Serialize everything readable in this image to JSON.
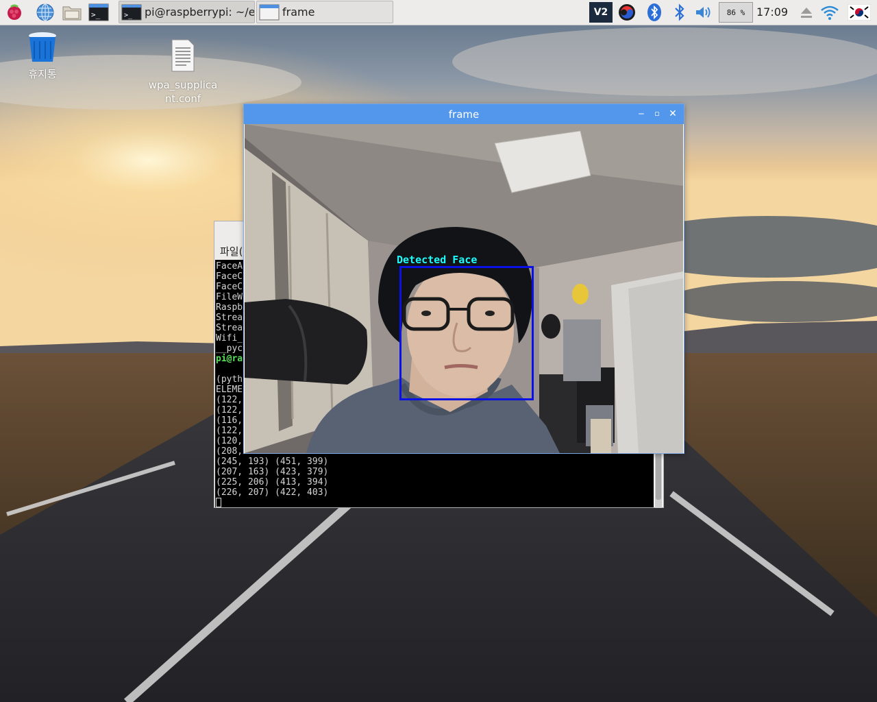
{
  "taskbar": {
    "launchers": [
      {
        "name": "raspberry-menu-icon"
      },
      {
        "name": "web-browser-icon"
      },
      {
        "name": "file-manager-icon"
      },
      {
        "name": "terminal-launcher-icon"
      }
    ],
    "tasks": [
      {
        "label": "pi@raspberrypi: ~/ex…",
        "icon": "terminal-icon"
      },
      {
        "label": "frame",
        "icon": "window-icon"
      }
    ],
    "tray": {
      "vnc": "VNC",
      "cpu_usage": "86 %",
      "clock": "17:09"
    }
  },
  "desktop": {
    "icons": [
      {
        "label": "휴지통",
        "icon": "trash-icon"
      },
      {
        "label_line1": "wpa_supplica",
        "label_line2": "nt.conf",
        "icon": "text-file-icon"
      }
    ]
  },
  "terminal": {
    "menu_label": "파일(",
    "lines": [
      {
        "text": "FaceA",
        "style": "normal"
      },
      {
        "text": "FaceC",
        "style": "normal"
      },
      {
        "text": "FaceC",
        "style": "normal"
      },
      {
        "text": "FileW",
        "style": "normal"
      },
      {
        "text": "Raspb",
        "style": "normal"
      },
      {
        "text": "Strea",
        "style": "normal"
      },
      {
        "text": "Strea",
        "style": "normal"
      },
      {
        "text": "Wifi_",
        "style": "normal"
      },
      {
        "text": "__pyc",
        "style": "normal"
      },
      {
        "text": "pi@ra",
        "style": "prompt"
      },
      {
        "text": "",
        "style": "normal"
      },
      {
        "text": "(pyth",
        "style": "normal"
      },
      {
        "text": "ELEME",
        "style": "normal"
      },
      {
        "text": "(122,",
        "style": "normal"
      },
      {
        "text": "(122,",
        "style": "normal"
      },
      {
        "text": "(116,",
        "style": "normal"
      },
      {
        "text": "(122,",
        "style": "normal"
      },
      {
        "text": "(120,",
        "style": "normal"
      },
      {
        "text": "(208,",
        "style": "normal"
      },
      {
        "text": "(245, 193) (451, 399)",
        "style": "normal"
      },
      {
        "text": "(207, 163) (423, 379)",
        "style": "normal"
      },
      {
        "text": "(225, 206) (413, 394)",
        "style": "normal"
      },
      {
        "text": "(226, 207) (422, 403)",
        "style": "normal"
      }
    ]
  },
  "frame_window": {
    "title": "frame",
    "detection_label": "Detected Face",
    "box_color": "#0a11e6",
    "label_color": "#1dfbfb"
  },
  "colors": {
    "titlebar": "#5397ec",
    "taskbar": "#edeceb",
    "prompt_green": "#5be35b"
  }
}
